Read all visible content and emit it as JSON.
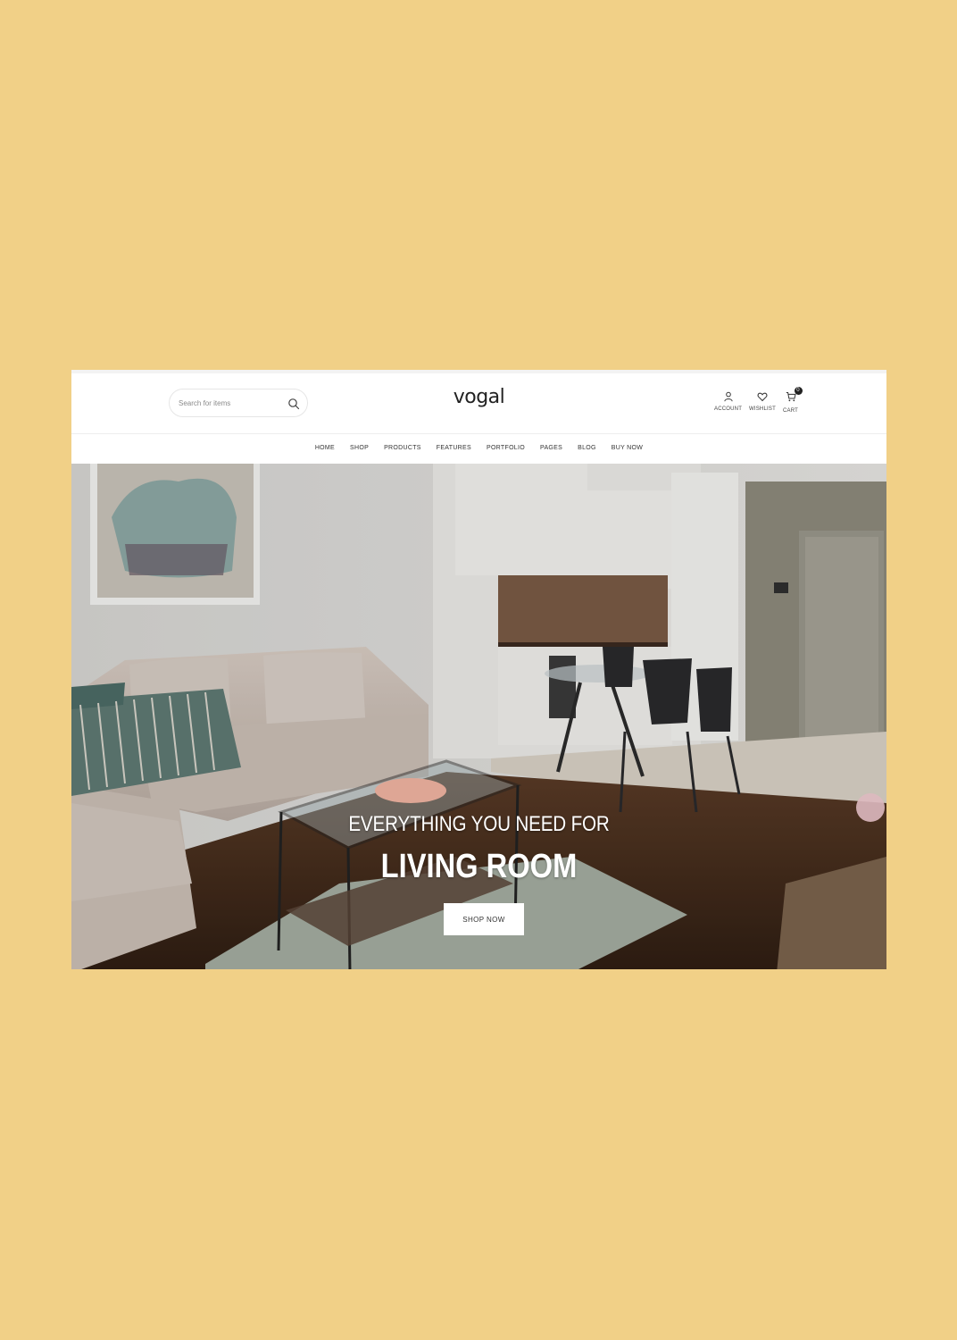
{
  "search": {
    "placeholder": "Search for items"
  },
  "brand": {
    "logo": "vogal"
  },
  "utilities": {
    "account_label": "ACCOUNT",
    "wishlist_label": "WISHLIST",
    "cart_label": "CART",
    "cart_count": "0"
  },
  "nav": {
    "items": [
      {
        "label": "HOME"
      },
      {
        "label": "SHOP"
      },
      {
        "label": "PRODUCTS"
      },
      {
        "label": "FEATURES"
      },
      {
        "label": "PORTFOLIO"
      },
      {
        "label": "PAGES"
      },
      {
        "label": "BLOG"
      },
      {
        "label": "BUY NOW"
      }
    ]
  },
  "hero": {
    "subtitle": "EVERYTHING YOU NEED FOR",
    "title": "LIVING ROOM",
    "button_label": "SHOP NOW"
  },
  "colors": {
    "page_background": "#f1d087",
    "header_background": "#ffffff",
    "button_background": "#ffffff",
    "text_dark": "#222222"
  }
}
